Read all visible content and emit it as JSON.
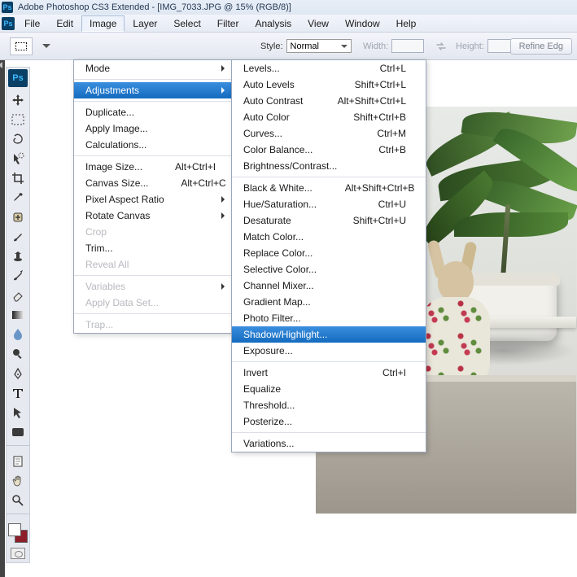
{
  "app": {
    "title": "Adobe Photoshop CS3 Extended - [IMG_7033.JPG @ 15% (RGB/8)]",
    "logo_text": "Ps"
  },
  "menubar": [
    "File",
    "Edit",
    "Image",
    "Layer",
    "Select",
    "Filter",
    "Analysis",
    "View",
    "Window",
    "Help"
  ],
  "options": {
    "style_label": "Style:",
    "style_value": "Normal",
    "width_label": "Width:",
    "height_label": "Height:",
    "refine": "Refine Edg"
  },
  "image_menu": {
    "mode": "Mode",
    "adjustments": "Adjustments",
    "duplicate": "Duplicate...",
    "apply_image": "Apply Image...",
    "calculations": "Calculations...",
    "image_size": {
      "label": "Image Size...",
      "shortcut": "Alt+Ctrl+I"
    },
    "canvas_size": {
      "label": "Canvas Size...",
      "shortcut": "Alt+Ctrl+C"
    },
    "pixel_aspect": "Pixel Aspect Ratio",
    "rotate_canvas": "Rotate Canvas",
    "crop": "Crop",
    "trim": "Trim...",
    "reveal_all": "Reveal All",
    "variables": "Variables",
    "apply_data_set": "Apply Data Set...",
    "trap": "Trap..."
  },
  "adjust_menu": {
    "levels": {
      "label": "Levels...",
      "shortcut": "Ctrl+L"
    },
    "auto_levels": {
      "label": "Auto Levels",
      "shortcut": "Shift+Ctrl+L"
    },
    "auto_contrast": {
      "label": "Auto Contrast",
      "shortcut": "Alt+Shift+Ctrl+L"
    },
    "auto_color": {
      "label": "Auto Color",
      "shortcut": "Shift+Ctrl+B"
    },
    "curves": {
      "label": "Curves...",
      "shortcut": "Ctrl+M"
    },
    "color_balance": {
      "label": "Color Balance...",
      "shortcut": "Ctrl+B"
    },
    "brightness_contrast": "Brightness/Contrast...",
    "black_white": {
      "label": "Black & White...",
      "shortcut": "Alt+Shift+Ctrl+B"
    },
    "hue_sat": {
      "label": "Hue/Saturation...",
      "shortcut": "Ctrl+U"
    },
    "desaturate": {
      "label": "Desaturate",
      "shortcut": "Shift+Ctrl+U"
    },
    "match_color": "Match Color...",
    "replace_color": "Replace Color...",
    "selective_color": "Selective Color...",
    "channel_mixer": "Channel Mixer...",
    "gradient_map": "Gradient Map...",
    "photo_filter": "Photo Filter...",
    "shadow_highlight": "Shadow/Highlight...",
    "exposure": "Exposure...",
    "invert": {
      "label": "Invert",
      "shortcut": "Ctrl+I"
    },
    "equalize": "Equalize",
    "threshold": "Threshold...",
    "posterize": "Posterize...",
    "variations": "Variations..."
  },
  "tools": [
    "move-tool",
    "marquee-tool",
    "lasso-tool",
    "quick-select-tool",
    "crop-tool",
    "eyedropper-tool",
    "healing-brush-tool",
    "brush-tool",
    "clone-stamp-tool",
    "history-brush-tool",
    "eraser-tool",
    "gradient-tool",
    "blur-tool",
    "dodge-tool",
    "pen-tool",
    "type-tool",
    "path-select-tool",
    "shape-tool",
    "notes-tool",
    "hand-tool",
    "zoom-tool"
  ]
}
